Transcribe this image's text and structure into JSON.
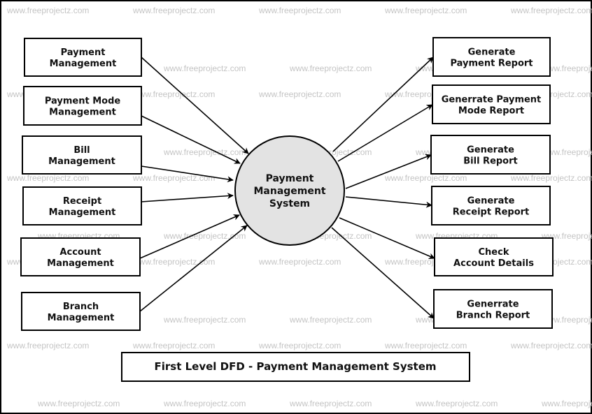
{
  "diagram": {
    "title": "First Level DFD - Payment Management System",
    "watermark": "www.freeprojectz.com",
    "colors": {
      "process_fill": "#e3e3e3",
      "stroke": "#000000",
      "watermark": "#c4c4c4"
    },
    "process": {
      "id": "pms",
      "lines": [
        "Payment",
        "Management",
        "System"
      ]
    },
    "inputs": [
      {
        "id": "in1",
        "lines": [
          "Payment",
          "Management"
        ]
      },
      {
        "id": "in2",
        "lines": [
          "Payment Mode",
          "Management"
        ]
      },
      {
        "id": "in3",
        "lines": [
          "Bill",
          "Management"
        ]
      },
      {
        "id": "in4",
        "lines": [
          "Receipt",
          "Management"
        ]
      },
      {
        "id": "in5",
        "lines": [
          "Account",
          "Management"
        ]
      },
      {
        "id": "in6",
        "lines": [
          "Branch",
          "Management"
        ]
      }
    ],
    "outputs": [
      {
        "id": "out1",
        "lines": [
          "Generate",
          "Payment Report"
        ]
      },
      {
        "id": "out2",
        "lines": [
          "Generrate Payment",
          "Mode Report"
        ]
      },
      {
        "id": "out3",
        "lines": [
          "Generate",
          "Bill Report"
        ]
      },
      {
        "id": "out4",
        "lines": [
          "Generate",
          "Receipt Report"
        ]
      },
      {
        "id": "out5",
        "lines": [
          "Check",
          "Account Details"
        ]
      },
      {
        "id": "out6",
        "lines": [
          "Generrate",
          "Branch Report"
        ]
      }
    ],
    "flows": [
      {
        "from": "in1",
        "to": "pms"
      },
      {
        "from": "in2",
        "to": "pms"
      },
      {
        "from": "in3",
        "to": "pms"
      },
      {
        "from": "in4",
        "to": "pms"
      },
      {
        "from": "in5",
        "to": "pms"
      },
      {
        "from": "in6",
        "to": "pms"
      },
      {
        "from": "pms",
        "to": "out1"
      },
      {
        "from": "pms",
        "to": "out2"
      },
      {
        "from": "pms",
        "to": "out3"
      },
      {
        "from": "pms",
        "to": "out4"
      },
      {
        "from": "pms",
        "to": "out5"
      },
      {
        "from": "pms",
        "to": "out6"
      }
    ]
  }
}
